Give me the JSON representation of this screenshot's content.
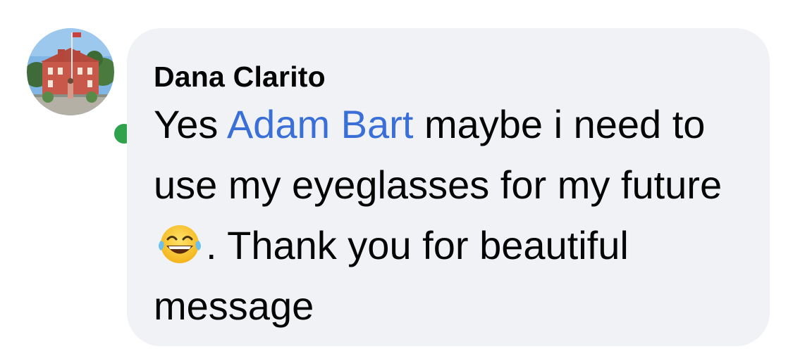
{
  "comment": {
    "author": "Dana Clarito",
    "text_before_mention": "Yes ",
    "mention": "Adam Bart",
    "text_after_mention": " maybe i need to use my eyeglasses for my future ",
    "emoji": "face-with-tears-of-joy",
    "text_after_emoji": ". Thank you for beautiful message"
  },
  "avatar": {
    "online": true,
    "online_color": "#31a24c"
  },
  "colors": {
    "bubble": "#f0f2f5",
    "mention": "#3a6fd8",
    "text": "#050505"
  }
}
